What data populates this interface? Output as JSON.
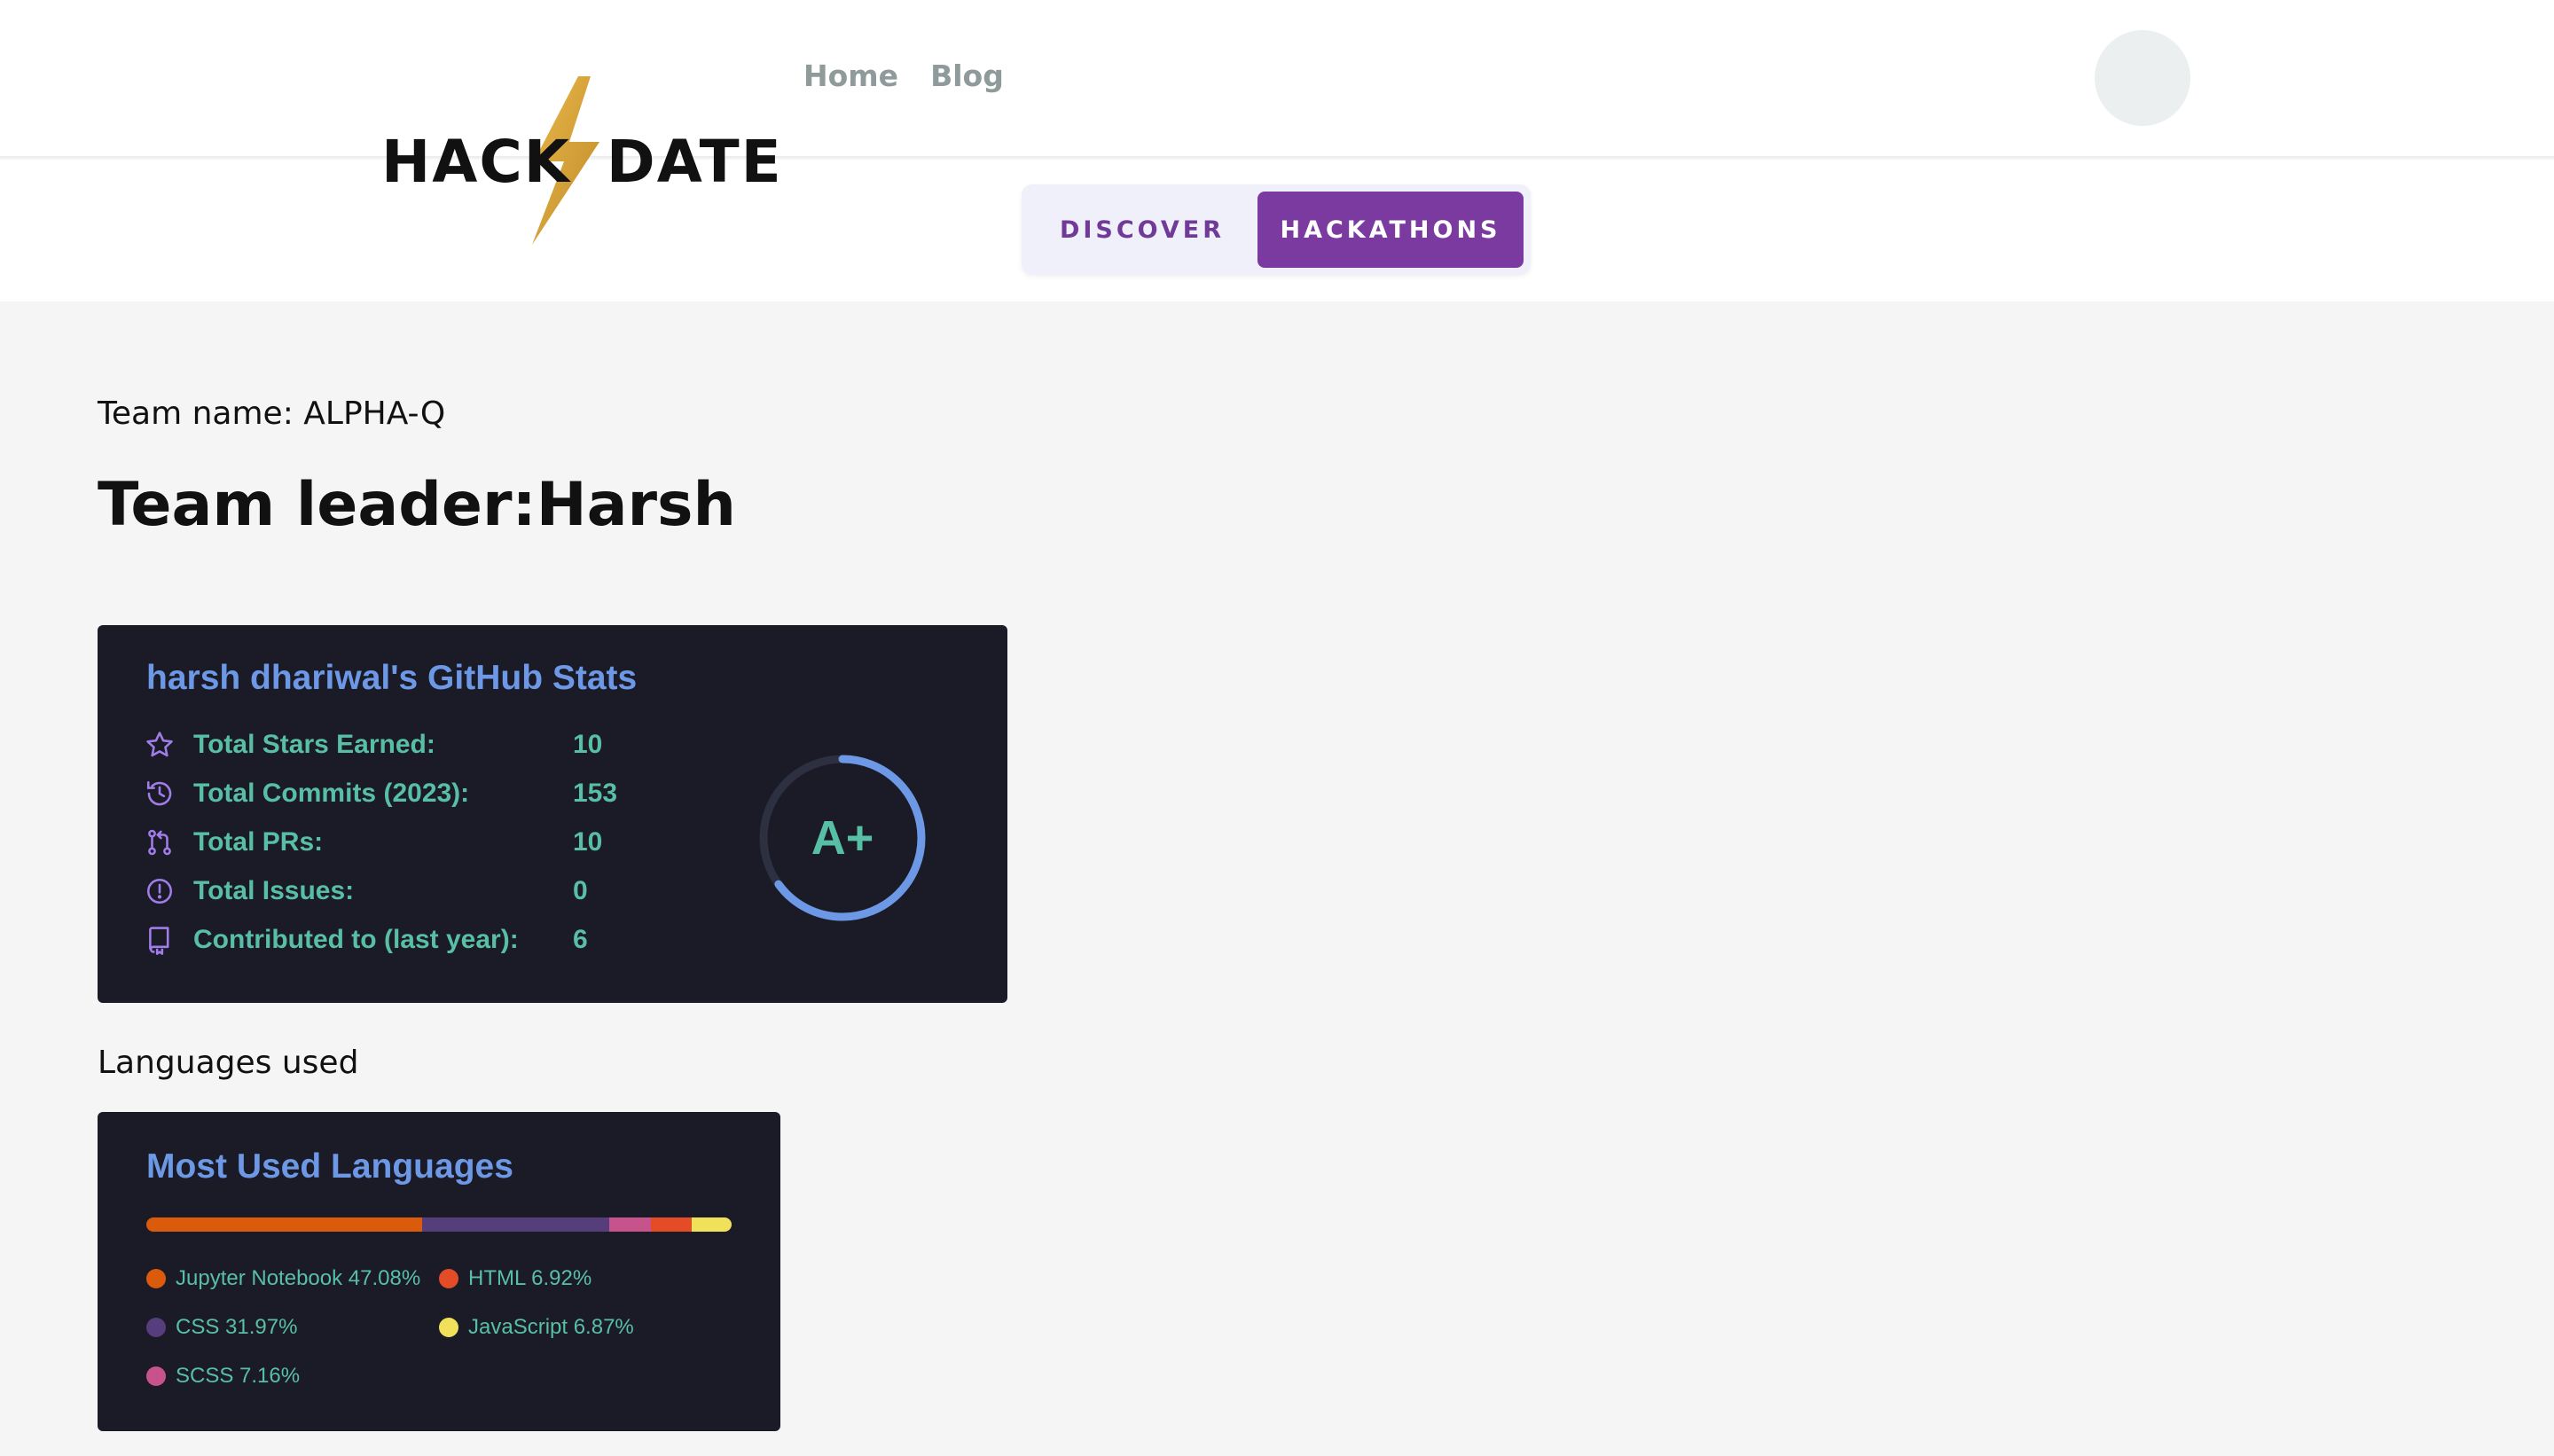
{
  "header": {
    "logo_text": "HACK DATE",
    "nav": [
      "Home",
      "Blog"
    ]
  },
  "toggle": {
    "discover": "DISCOVER",
    "hackathons": "HACKATHONS",
    "active": "hackathons"
  },
  "team": {
    "name_line": "Team name: ALPHA-Q",
    "leader_line": "Team leader:Harsh"
  },
  "github_stats": {
    "title": "harsh dhariwal's GitHub Stats",
    "rows": [
      {
        "icon": "star-icon",
        "label": "Total Stars Earned:",
        "value": "10"
      },
      {
        "icon": "history-icon",
        "label": "Total Commits (2023):",
        "value": "153"
      },
      {
        "icon": "pull-request-icon",
        "label": "Total PRs:",
        "value": "10"
      },
      {
        "icon": "issue-icon",
        "label": "Total Issues:",
        "value": "0"
      },
      {
        "icon": "repo-icon",
        "label": "Contributed to (last year):",
        "value": "6"
      }
    ],
    "rank": "A+",
    "rank_progress_percent": 65
  },
  "languages": {
    "section_label": "Languages used",
    "title": "Most Used Languages",
    "items": [
      {
        "name": "Jupyter Notebook",
        "percent": 47.08,
        "text": "Jupyter Notebook 47.08%",
        "color": "#DA5B0B"
      },
      {
        "name": "CSS",
        "percent": 31.97,
        "text": "CSS 31.97%",
        "color": "#563d7c"
      },
      {
        "name": "SCSS",
        "percent": 7.16,
        "text": "SCSS 7.16%",
        "color": "#c6538c"
      },
      {
        "name": "HTML",
        "percent": 6.92,
        "text": "HTML 6.92%",
        "color": "#e34c26"
      },
      {
        "name": "JavaScript",
        "percent": 6.87,
        "text": "JavaScript 6.87%",
        "color": "#f1e05a"
      }
    ]
  },
  "colors": {
    "accent": "#7b3aa0",
    "card_bg": "#1b1b27",
    "card_title": "#6c98e6",
    "card_text": "#58bfa6",
    "icon": "#a07de8"
  }
}
